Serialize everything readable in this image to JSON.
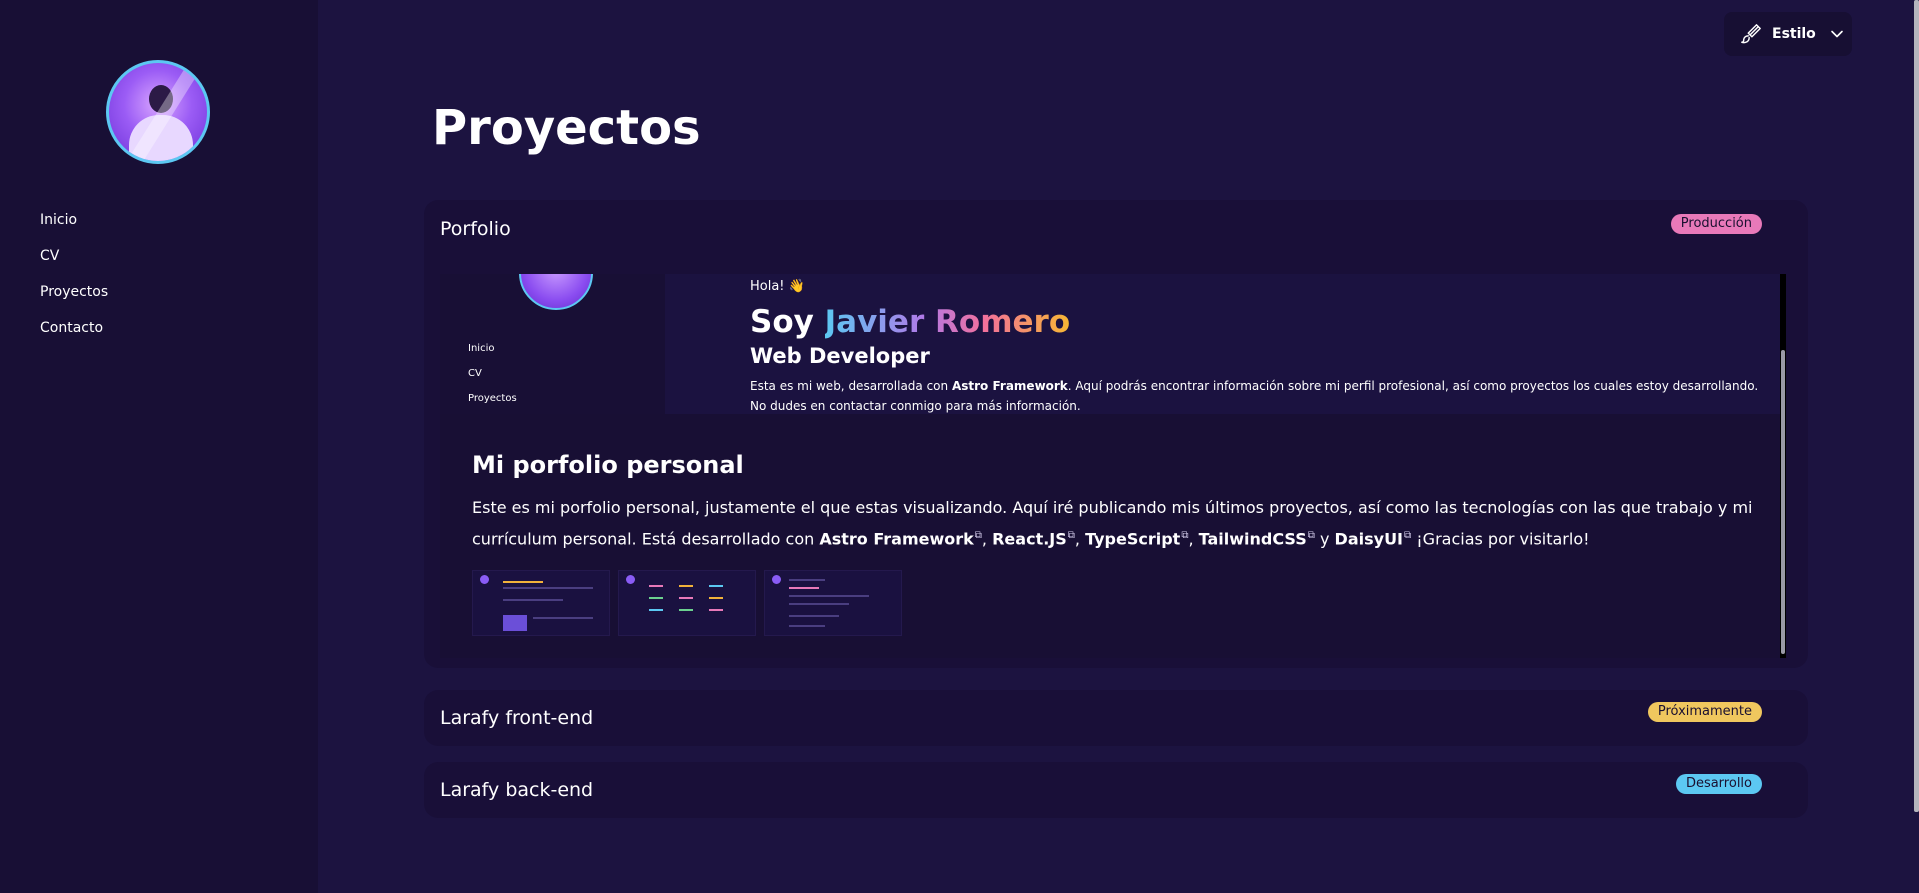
{
  "nav": {
    "items": [
      "Inicio",
      "CV",
      "Proyectos",
      "Contacto"
    ]
  },
  "style_button": {
    "label": "Estilo",
    "icon": "paintbrush-icon"
  },
  "page": {
    "title": "Proyectos"
  },
  "projects": [
    {
      "title": "Porfolio",
      "badge": "Producción",
      "badge_color": "#e879b9",
      "preview": {
        "greeting": "Hola! 👋",
        "soy": "Soy",
        "name": "Javier Romero",
        "role": "Web Developer",
        "desc_before": "Esta es mi web, desarrollada con",
        "desc_bold": "Astro Framework",
        "desc_after": ". Aquí podrás encontrar información sobre mi perfil profesional, así como proyectos los cuales estoy desarrollando. No dudes en contactar conmigo para más información.",
        "nav": [
          "Inicio",
          "CV",
          "Proyectos"
        ]
      },
      "heading": "Mi porfolio personal",
      "desc1": "Este es mi porfolio personal, justamente el que estas visualizando. Aquí iré publicando mis últimos proyectos, así como las tecnologías con las que trabajo y mi currículum personal.",
      "desc2_prefix": "Está desarrollado con",
      "links": [
        "Astro Framework",
        "React.JS",
        "TypeScript",
        "TailwindCSS",
        "DaisyUI"
      ],
      "sep_comma": ",",
      "sep_and": "y",
      "thanks": "¡Gracias por visitarlo!"
    },
    {
      "title": "Larafy front-end",
      "badge": "Próximamente",
      "badge_color": "#f0c75e"
    },
    {
      "title": "Larafy back-end",
      "badge": "Desarrollo",
      "badge_color": "#5cc8f2"
    }
  ]
}
